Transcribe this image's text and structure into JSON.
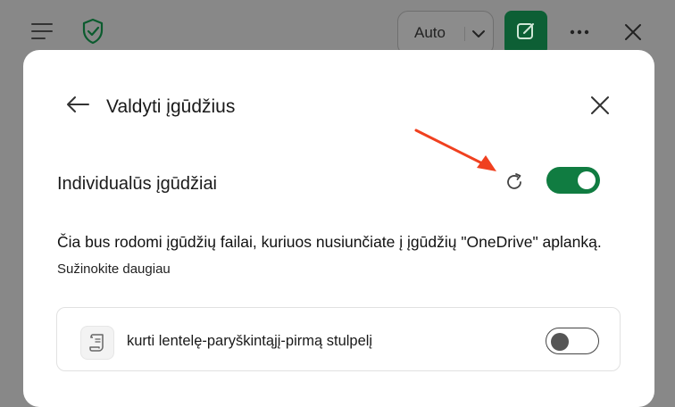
{
  "topbar": {
    "menu_icon": "hamburger-menu-icon",
    "shield_icon": "shield-check-icon",
    "auto_select_value": "Auto",
    "compose_icon": "compose-edit-icon",
    "more_icon": "more-dots-icon",
    "close_icon": "close-icon"
  },
  "panel": {
    "title": "Valdyti įgūdžius",
    "section_title": "Individualūs įgūdžiai",
    "description": "Čia bus rodomi įgūdžių failai, kuriuos nusiunčiate į įgūdžių \"OneDrive\" aplanką.",
    "learn_more": "Sužinokite daugiau",
    "custom_skills_enabled": true,
    "skills": [
      {
        "label": "kurti lentelę-paryškintąjį-pirmą stulpelį",
        "enabled": false
      }
    ]
  },
  "colors": {
    "accent_green": "#107c41",
    "compose_green": "#0d5f35",
    "arrow_red": "#f0401f",
    "overlay_gray": "#888888"
  }
}
